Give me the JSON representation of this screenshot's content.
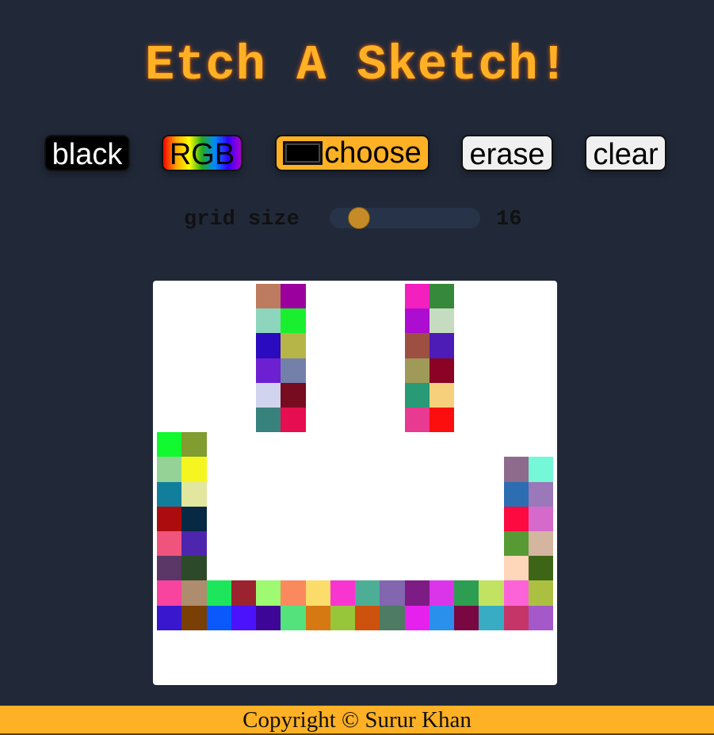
{
  "title": "Etch A Sketch!",
  "buttons": {
    "black": "black",
    "rgb": "RGB",
    "choose": "choose",
    "erase": "erase",
    "clear": "clear"
  },
  "choose_color": "#000000",
  "grid_size": {
    "label": "grid size",
    "value": "16",
    "slider_fraction": 0.14
  },
  "board": {
    "size": 16,
    "background": "#ffffff",
    "cells": [
      {
        "row": 0,
        "col": 4,
        "color": "#bd7b5f"
      },
      {
        "row": 0,
        "col": 5,
        "color": "#9b009f"
      },
      {
        "row": 0,
        "col": 10,
        "color": "#f31fbe"
      },
      {
        "row": 0,
        "col": 11,
        "color": "#36883a"
      },
      {
        "row": 1,
        "col": 4,
        "color": "#8dd6bd"
      },
      {
        "row": 1,
        "col": 5,
        "color": "#19ef2e"
      },
      {
        "row": 1,
        "col": 10,
        "color": "#ac0dd0"
      },
      {
        "row": 1,
        "col": 11,
        "color": "#c6dcc1"
      },
      {
        "row": 2,
        "col": 4,
        "color": "#2a0bbf"
      },
      {
        "row": 2,
        "col": 5,
        "color": "#b6b548"
      },
      {
        "row": 2,
        "col": 10,
        "color": "#9d4f42"
      },
      {
        "row": 2,
        "col": 11,
        "color": "#4d1bb5"
      },
      {
        "row": 3,
        "col": 4,
        "color": "#6c20d2"
      },
      {
        "row": 3,
        "col": 5,
        "color": "#7380aa"
      },
      {
        "row": 3,
        "col": 10,
        "color": "#9f9a58"
      },
      {
        "row": 3,
        "col": 11,
        "color": "#8a0224"
      },
      {
        "row": 4,
        "col": 4,
        "color": "#d0d4ee"
      },
      {
        "row": 4,
        "col": 5,
        "color": "#770b20"
      },
      {
        "row": 4,
        "col": 10,
        "color": "#289a76"
      },
      {
        "row": 4,
        "col": 11,
        "color": "#f6d07a"
      },
      {
        "row": 5,
        "col": 4,
        "color": "#37827c"
      },
      {
        "row": 5,
        "col": 5,
        "color": "#e60d50"
      },
      {
        "row": 5,
        "col": 10,
        "color": "#e83a91"
      },
      {
        "row": 5,
        "col": 11,
        "color": "#fb0e0d"
      },
      {
        "row": 6,
        "col": 0,
        "color": "#10fa2f"
      },
      {
        "row": 6,
        "col": 1,
        "color": "#819c2f"
      },
      {
        "row": 7,
        "col": 0,
        "color": "#94d296"
      },
      {
        "row": 7,
        "col": 1,
        "color": "#f5f61f"
      },
      {
        "row": 7,
        "col": 14,
        "color": "#8e6b8c"
      },
      {
        "row": 7,
        "col": 15,
        "color": "#75f8d8"
      },
      {
        "row": 8,
        "col": 0,
        "color": "#117f9c"
      },
      {
        "row": 8,
        "col": 1,
        "color": "#e2e7a0"
      },
      {
        "row": 8,
        "col": 14,
        "color": "#2d6db2"
      },
      {
        "row": 8,
        "col": 15,
        "color": "#9a78b9"
      },
      {
        "row": 9,
        "col": 0,
        "color": "#ad0c0e"
      },
      {
        "row": 9,
        "col": 1,
        "color": "#082943"
      },
      {
        "row": 9,
        "col": 14,
        "color": "#fd0a40"
      },
      {
        "row": 9,
        "col": 15,
        "color": "#d56acc"
      },
      {
        "row": 10,
        "col": 0,
        "color": "#f0547c"
      },
      {
        "row": 10,
        "col": 1,
        "color": "#4d26ad"
      },
      {
        "row": 10,
        "col": 14,
        "color": "#579a34"
      },
      {
        "row": 10,
        "col": 15,
        "color": "#d3b5a0"
      },
      {
        "row": 11,
        "col": 0,
        "color": "#5a3766"
      },
      {
        "row": 11,
        "col": 1,
        "color": "#2c4a2a"
      },
      {
        "row": 11,
        "col": 14,
        "color": "#fed6ba"
      },
      {
        "row": 11,
        "col": 15,
        "color": "#3e6515"
      },
      {
        "row": 12,
        "col": 0,
        "color": "#f8449f"
      },
      {
        "row": 12,
        "col": 1,
        "color": "#ae8c6e"
      },
      {
        "row": 12,
        "col": 2,
        "color": "#1ee65c"
      },
      {
        "row": 12,
        "col": 3,
        "color": "#9b232f"
      },
      {
        "row": 12,
        "col": 4,
        "color": "#9efa70"
      },
      {
        "row": 12,
        "col": 5,
        "color": "#fa8a5e"
      },
      {
        "row": 12,
        "col": 6,
        "color": "#fcdc6b"
      },
      {
        "row": 12,
        "col": 7,
        "color": "#f935d0"
      },
      {
        "row": 12,
        "col": 8,
        "color": "#4dae95"
      },
      {
        "row": 12,
        "col": 9,
        "color": "#8266af"
      },
      {
        "row": 12,
        "col": 10,
        "color": "#7d1c85"
      },
      {
        "row": 12,
        "col": 11,
        "color": "#db35ea"
      },
      {
        "row": 12,
        "col": 12,
        "color": "#2d9d51"
      },
      {
        "row": 12,
        "col": 13,
        "color": "#c2e361"
      },
      {
        "row": 12,
        "col": 14,
        "color": "#fd63d9"
      },
      {
        "row": 12,
        "col": 15,
        "color": "#abc041"
      },
      {
        "row": 13,
        "col": 0,
        "color": "#3817cf"
      },
      {
        "row": 13,
        "col": 1,
        "color": "#7a3f05"
      },
      {
        "row": 13,
        "col": 2,
        "color": "#0b59fb"
      },
      {
        "row": 13,
        "col": 3,
        "color": "#4b13fb"
      },
      {
        "row": 13,
        "col": 4,
        "color": "#3e0696"
      },
      {
        "row": 13,
        "col": 5,
        "color": "#53e27c"
      },
      {
        "row": 13,
        "col": 6,
        "color": "#d77913"
      },
      {
        "row": 13,
        "col": 7,
        "color": "#98c63b"
      },
      {
        "row": 13,
        "col": 8,
        "color": "#cc520d"
      },
      {
        "row": 13,
        "col": 9,
        "color": "#4d7b63"
      },
      {
        "row": 13,
        "col": 10,
        "color": "#e621ee"
      },
      {
        "row": 13,
        "col": 11,
        "color": "#2b90ec"
      },
      {
        "row": 13,
        "col": 12,
        "color": "#790741"
      },
      {
        "row": 13,
        "col": 13,
        "color": "#37acc3"
      },
      {
        "row": 13,
        "col": 14,
        "color": "#c63567"
      },
      {
        "row": 13,
        "col": 15,
        "color": "#a558c9"
      }
    ]
  },
  "footer": "Copyright © Surur Khan"
}
